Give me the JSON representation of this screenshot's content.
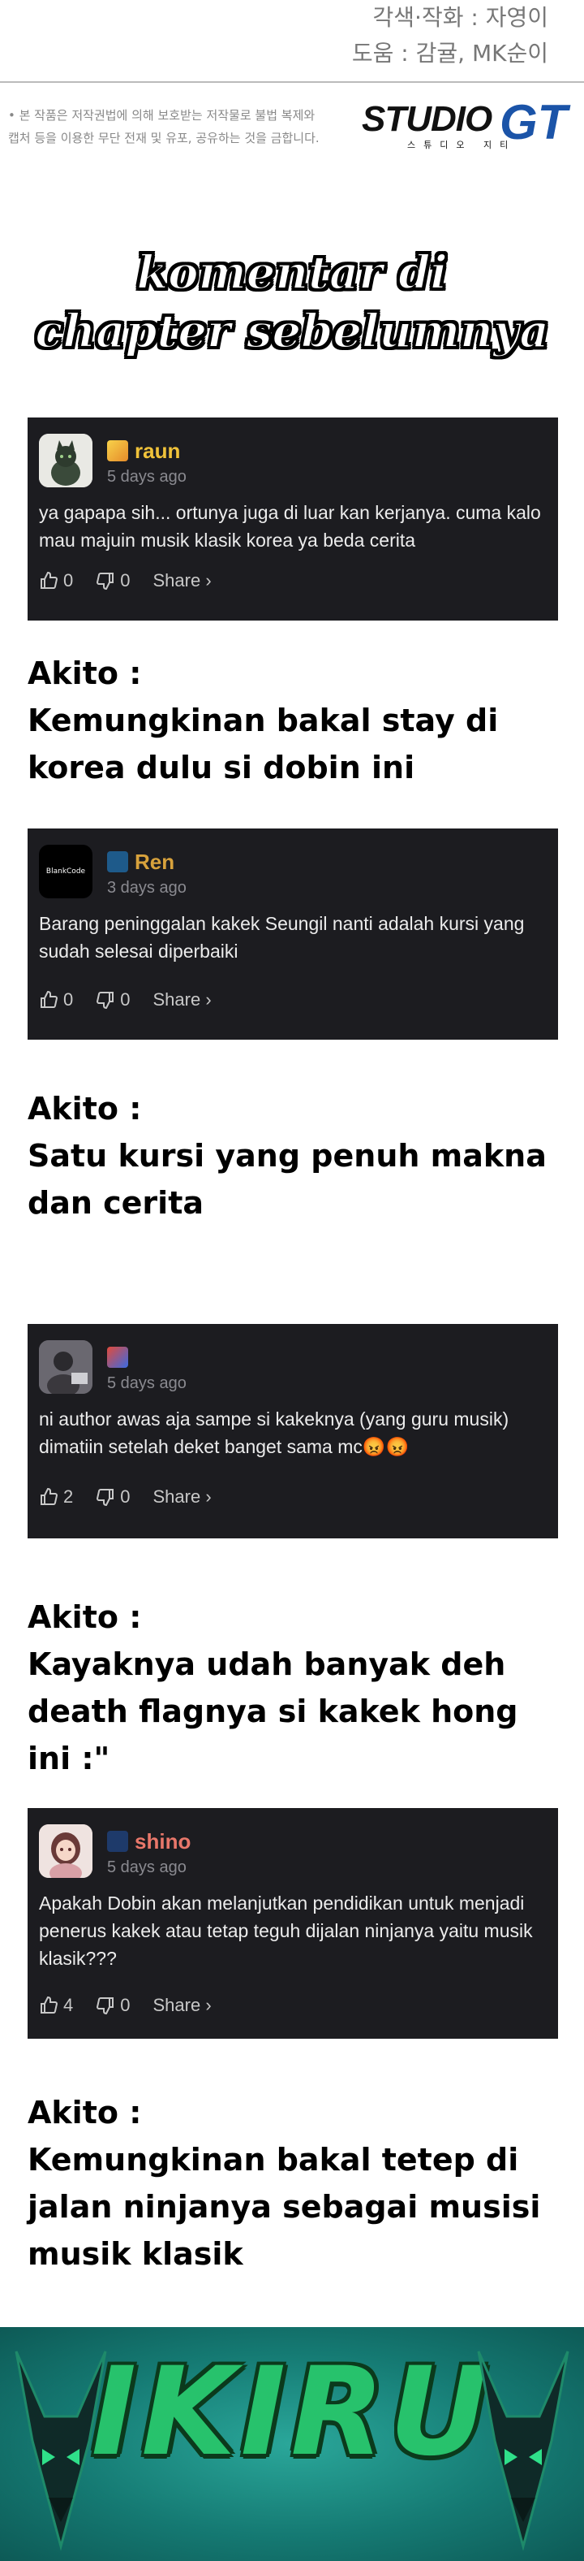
{
  "credits": {
    "line1": "각색·작화 : 자영이",
    "line2": "도움 : 감귤, MK순이"
  },
  "notice": {
    "line1": "• 본 작품은 저작권법에 의해 보호받는 저작물로 불법 복제와",
    "line2": "캡처 등을 이용한 무단 전재 및 유포, 공유하는 것을 금합니다."
  },
  "studio": {
    "text": "STUDIO",
    "gt": "GT",
    "sub": "스튜디오 지티"
  },
  "headline": {
    "line1": "komentar di",
    "line2": "chapter sebelumnya"
  },
  "comments": [
    {
      "username": "raun",
      "username_color": "#f0c23a",
      "time": "5 days ago",
      "text": "ya gapapa sih... ortunya juga di luar kan kerjanya. cuma kalo mau majuin musik klasik korea ya beda cerita",
      "likes": "0",
      "dislikes": "0",
      "share": "Share ›",
      "avatar_icon": "cat-avatar-icon"
    },
    {
      "username": "Ren",
      "username_color": "#d8a23c",
      "time": "3 days ago",
      "text": "Barang peninggalan kakek Seungil nanti adalah kursi yang sudah selesai diperbaiki",
      "likes": "0",
      "dislikes": "0",
      "share": "Share ›",
      "avatar_text": "BlankCode"
    },
    {
      "username": "",
      "username_color": "#ffffff",
      "time": "5 days ago",
      "text": "ni author awas aja sampe si kakeknya (yang guru musik) dimatiin setelah deket banget sama mc😡😡",
      "likes": "2",
      "dislikes": "0",
      "share": "Share ›",
      "avatar_icon": "person-avatar-icon"
    },
    {
      "username": "shino",
      "username_color": "#e8776a",
      "time": "5 days ago",
      "text": "Apakah Dobin akan melanjutkan pendidikan untuk menjadi penerus kakek atau tetap teguh dijalan ninjanya yaitu musik klasik???",
      "likes": "4",
      "dislikes": "0",
      "share": "Share ›",
      "avatar_icon": "anime-girl-avatar-icon"
    }
  ],
  "akito_notes": [
    {
      "label": "Akito :",
      "text": "Kemungkinan bakal stay di korea dulu si dobin ini"
    },
    {
      "label": "Akito :",
      "text": "Satu kursi yang penuh makna dan cerita"
    },
    {
      "label": "Akito :",
      "text": "Kayaknya udah banyak deh death flagnya si kakek hong ini :\""
    },
    {
      "label": "Akito :",
      "text": "Kemungkinan bakal tetep di jalan ninjanya sebagai musisi musik klasik"
    }
  ],
  "footer": {
    "logo_text": "IKIRU"
  }
}
